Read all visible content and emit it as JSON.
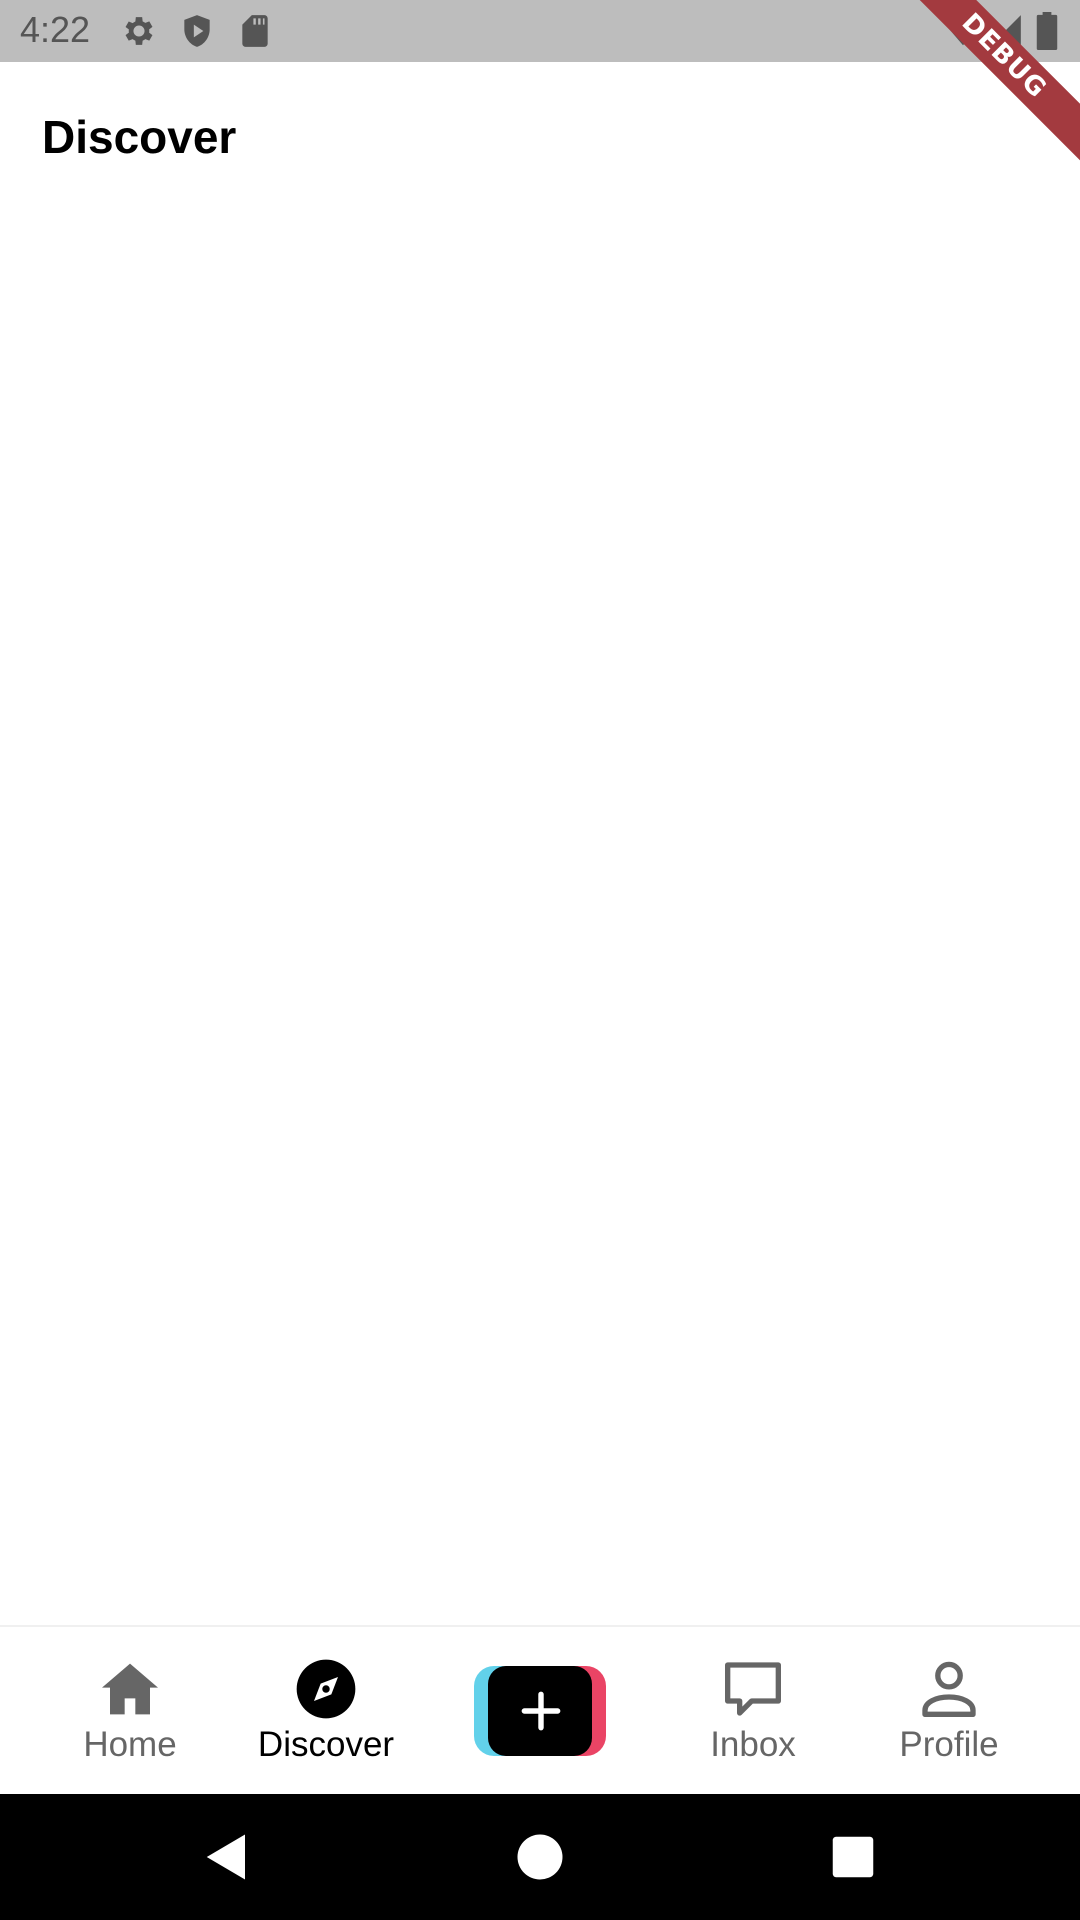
{
  "status_bar": {
    "time": "4:22",
    "icons": [
      "gear-icon",
      "shield-play-icon",
      "sd-card-icon",
      "wifi-icon",
      "cell-signal-icon",
      "battery-icon"
    ]
  },
  "debug_banner": {
    "label": "DEBUG"
  },
  "app_bar": {
    "title": "Discover"
  },
  "bottom_nav": {
    "active": "discover",
    "items": [
      {
        "id": "home",
        "label": "Home",
        "icon": "home-icon"
      },
      {
        "id": "discover",
        "label": "Discover",
        "icon": "compass-icon"
      },
      {
        "id": "create",
        "label": "",
        "icon": "plus-icon"
      },
      {
        "id": "inbox",
        "label": "Inbox",
        "icon": "chat-bubble-icon"
      },
      {
        "id": "profile",
        "label": "Profile",
        "icon": "person-icon"
      }
    ]
  },
  "system_nav": {
    "icons": [
      "back-icon",
      "home-circle-icon",
      "recents-icon"
    ]
  },
  "colors": {
    "status_bar_bg": "#bdbdbd",
    "debug_banner": "#a33a3f",
    "nav_inactive": "#666666",
    "nav_active": "#000000",
    "create_cyan": "#62d1ea",
    "create_red": "#ea4465"
  }
}
